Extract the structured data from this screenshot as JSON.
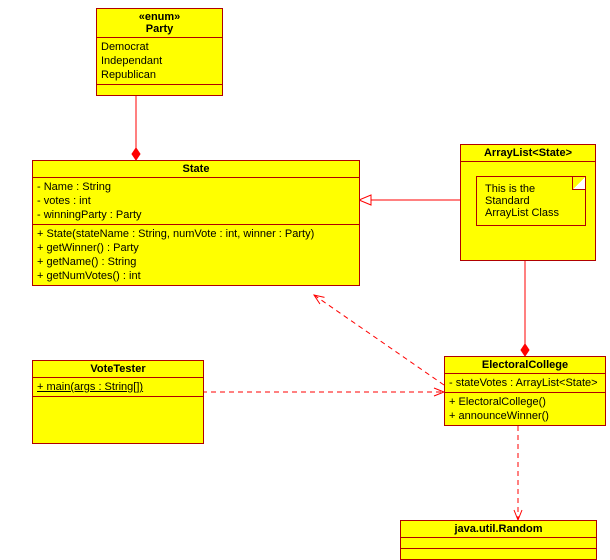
{
  "party": {
    "stereotype": "«enum»",
    "name": "Party",
    "values": [
      "Democrat",
      "Independant",
      "Republican"
    ]
  },
  "state": {
    "name": "State",
    "attrs": [
      "- Name : String",
      "- votes : int",
      "- winningParty : Party"
    ],
    "ops": [
      "+ State(stateName : String, numVote : int, winner : Party)",
      "+ getWinner() : Party",
      "+ getName() : String",
      "+ getNumVotes() : int"
    ]
  },
  "arraylist": {
    "name": "ArrayList<State>",
    "note": [
      "This is the",
      "Standard",
      "ArrayList Class"
    ]
  },
  "votetester": {
    "name": "VoteTester",
    "ops": [
      "+ main(args : String[])"
    ]
  },
  "electoral": {
    "name": "ElectoralCollege",
    "attrs": [
      "- stateVotes : ArrayList<State>"
    ],
    "ops": [
      "+ ElectoralCollege()",
      "+ announceWinner()"
    ]
  },
  "random": {
    "name": "java.util.Random"
  }
}
